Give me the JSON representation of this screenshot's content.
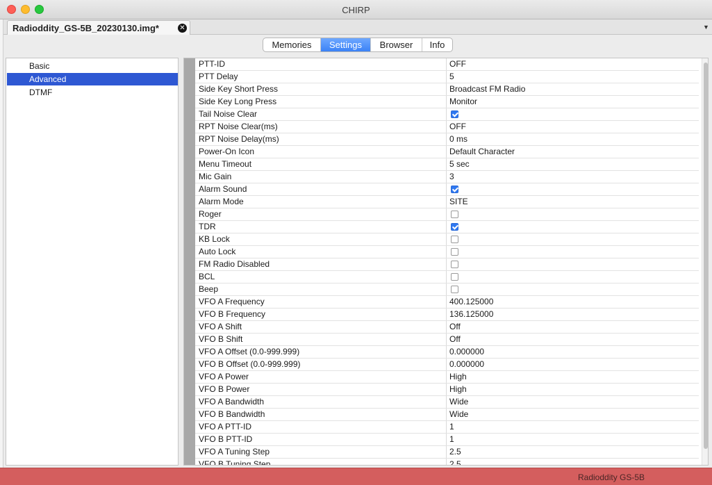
{
  "window": {
    "title": "CHIRP"
  },
  "file_tab": {
    "label": "Radioddity_GS-5B_20230130.img*"
  },
  "view_tabs": [
    {
      "label": "Memories",
      "active": false
    },
    {
      "label": "Settings",
      "active": true
    },
    {
      "label": "Browser",
      "active": false
    },
    {
      "label": "Info",
      "active": false
    }
  ],
  "tree": {
    "items": [
      {
        "label": "Basic",
        "selected": false
      },
      {
        "label": "Advanced",
        "selected": true
      },
      {
        "label": "DTMF",
        "selected": false
      }
    ]
  },
  "settings": {
    "rows": [
      {
        "name": "PTT-ID",
        "type": "text",
        "value": "OFF"
      },
      {
        "name": "PTT Delay",
        "type": "text",
        "value": "5"
      },
      {
        "name": "Side Key Short Press",
        "type": "text",
        "value": "Broadcast FM Radio"
      },
      {
        "name": "Side Key Long Press",
        "type": "text",
        "value": "Monitor"
      },
      {
        "name": "Tail Noise Clear",
        "type": "check",
        "checked": true
      },
      {
        "name": "RPT Noise Clear(ms)",
        "type": "text",
        "value": "OFF"
      },
      {
        "name": "RPT Noise Delay(ms)",
        "type": "text",
        "value": "0 ms"
      },
      {
        "name": "Power-On Icon",
        "type": "text",
        "value": "Default Character"
      },
      {
        "name": "Menu Timeout",
        "type": "text",
        "value": "5 sec"
      },
      {
        "name": "Mic Gain",
        "type": "text",
        "value": "3"
      },
      {
        "name": "Alarm Sound",
        "type": "check",
        "checked": true
      },
      {
        "name": "Alarm Mode",
        "type": "text",
        "value": "SITE"
      },
      {
        "name": "Roger",
        "type": "check",
        "checked": false
      },
      {
        "name": "TDR",
        "type": "check",
        "checked": true
      },
      {
        "name": "KB Lock",
        "type": "check",
        "checked": false
      },
      {
        "name": "Auto Lock",
        "type": "check",
        "checked": false
      },
      {
        "name": "FM Radio Disabled",
        "type": "check",
        "checked": false
      },
      {
        "name": "BCL",
        "type": "check",
        "checked": false
      },
      {
        "name": "Beep",
        "type": "check",
        "checked": false
      },
      {
        "name": "VFO A Frequency",
        "type": "text",
        "value": "400.125000"
      },
      {
        "name": "VFO B Frequency",
        "type": "text",
        "value": "136.125000"
      },
      {
        "name": "VFO A Shift",
        "type": "text",
        "value": "Off"
      },
      {
        "name": "VFO B Shift",
        "type": "text",
        "value": "Off"
      },
      {
        "name": "VFO A Offset (0.0-999.999)",
        "type": "text",
        "value": "0.000000"
      },
      {
        "name": "VFO B Offset (0.0-999.999)",
        "type": "text",
        "value": "0.000000"
      },
      {
        "name": "VFO A Power",
        "type": "text",
        "value": "High"
      },
      {
        "name": "VFO B Power",
        "type": "text",
        "value": "High"
      },
      {
        "name": "VFO A Bandwidth",
        "type": "text",
        "value": "Wide"
      },
      {
        "name": "VFO B Bandwidth",
        "type": "text",
        "value": "Wide"
      },
      {
        "name": "VFO A PTT-ID",
        "type": "text",
        "value": "1"
      },
      {
        "name": "VFO B PTT-ID",
        "type": "text",
        "value": "1"
      },
      {
        "name": "VFO A Tuning Step",
        "type": "text",
        "value": "2.5"
      },
      {
        "name": "VFO B Tuning Step",
        "type": "text",
        "value": "2.5"
      }
    ]
  },
  "status_bar": {
    "radio": "Radioddity GS-5B"
  },
  "colors": {
    "selection": "#2e58d3",
    "active_tab": "#3b82f6",
    "status_bar": "#d45e5e",
    "checkbox_on": "#2f78f0"
  },
  "icons": {
    "close_tab": "close-circle-icon",
    "tab_menu": "chevron-down-icon",
    "checkbox": "checkbox-icon"
  }
}
